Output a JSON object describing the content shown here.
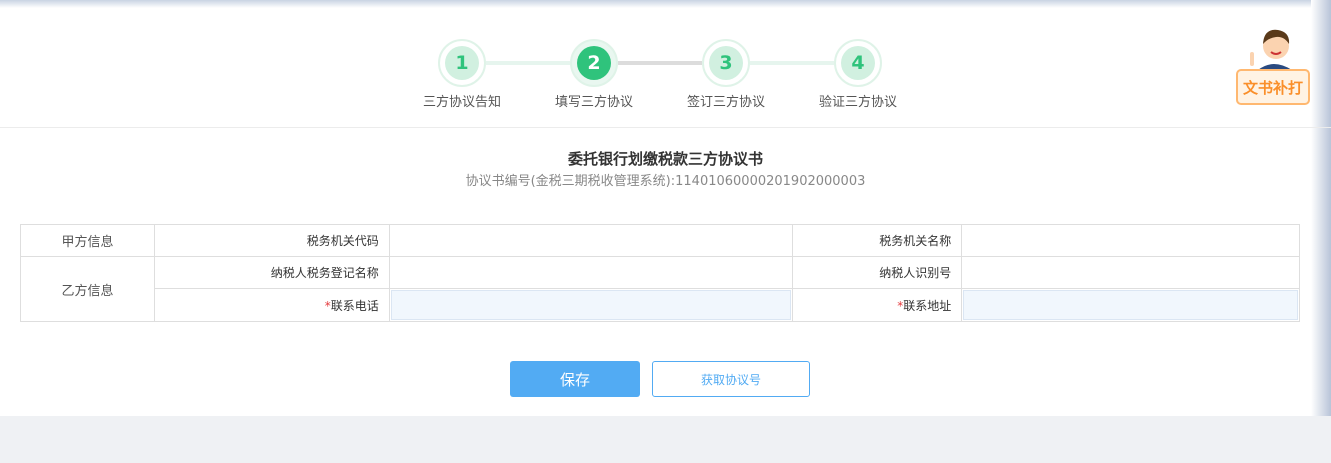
{
  "steps": [
    {
      "num": "1",
      "label": "三方协议告知"
    },
    {
      "num": "2",
      "label": "填写三方协议"
    },
    {
      "num": "3",
      "label": "签订三方协议"
    },
    {
      "num": "4",
      "label": "验证三方协议"
    }
  ],
  "reprint_label": "文书补打",
  "doc": {
    "title": "委托银行划缴税款三方协议书",
    "subtitle": "协议书编号(金税三期税收管理系统):11401060000201902000003"
  },
  "form": {
    "party_a": "甲方信息",
    "party_b": "乙方信息",
    "tax_office_code": "税务机关代码",
    "tax_office_name": "税务机关名称",
    "taxpayer_name": "纳税人税务登记名称",
    "taxpayer_id": "纳税人识别号",
    "required_mark": "*",
    "phone": "联系电话",
    "address": "联系地址"
  },
  "buttons": {
    "save": "保存",
    "get_number": "获取协议号"
  }
}
